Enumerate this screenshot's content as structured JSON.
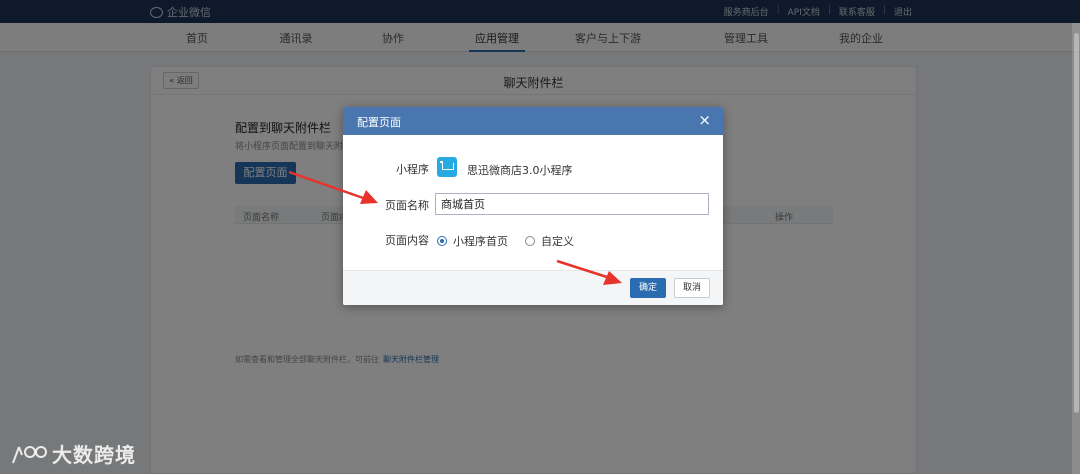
{
  "topbar": {
    "logo_text": "企业微信",
    "links": [
      "服务商后台",
      "API文档",
      "联系客服",
      "退出"
    ]
  },
  "nav": {
    "tabs": [
      {
        "label": "首页",
        "active": false
      },
      {
        "label": "通讯录",
        "active": false
      },
      {
        "label": "协作",
        "active": false
      },
      {
        "label": "应用管理",
        "active": true
      },
      {
        "label": "客户与上下游",
        "active": false
      },
      {
        "label": "管理工具",
        "active": false
      },
      {
        "label": "我的企业",
        "active": false
      }
    ]
  },
  "page": {
    "back_label": "« 返回",
    "title": "聊天附件栏",
    "section_title": "配置到聊天附件栏",
    "section_desc": "将小程序页面配置到聊天附件栏",
    "config_button": "配置页面",
    "table_headers": [
      "页面名称",
      "页面内容",
      "操作"
    ],
    "footnote": "如需查看和管理全部聊天附件栏，可前往",
    "footnote_link": "聊天附件栏管理"
  },
  "modal": {
    "title": "配置页面",
    "close_glyph": "×",
    "miniprogram_label": "小程序",
    "miniprogram_name": "思迅微商店3.0小程序",
    "page_name_label": "页面名称",
    "page_name_value": "商城首页",
    "page_content_label": "页面内容",
    "options": [
      {
        "label": "小程序首页",
        "checked": true
      },
      {
        "label": "自定义",
        "checked": false
      }
    ],
    "ok_label": "确定",
    "cancel_label": "取消"
  },
  "watermark": {
    "text": "大数跨境"
  },
  "colors": {
    "topbar": "#1d3557",
    "primary": "#2b6cb0",
    "modal_header": "#4a76b0",
    "arrow": "#e8322c"
  }
}
